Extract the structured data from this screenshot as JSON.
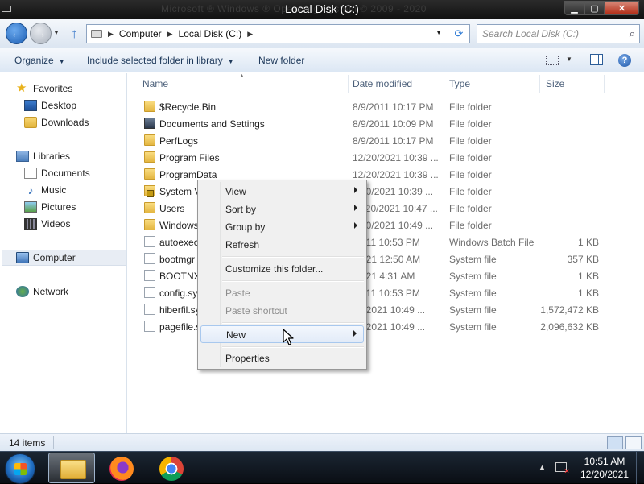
{
  "window": {
    "title": "Local Disk (C:)",
    "ghost_title": "Microsoft ® Windows ® Operating System © 2009 - 2020"
  },
  "address": {
    "crumbs": [
      "Computer",
      "Local Disk (C:)"
    ],
    "search_placeholder": "Search Local Disk (C:)"
  },
  "toolbar": {
    "organize": "Organize",
    "include": "Include selected folder in library",
    "new_folder": "New folder"
  },
  "nav": {
    "favorites": "Favorites",
    "desktop": "Desktop",
    "downloads": "Downloads",
    "libraries": "Libraries",
    "documents": "Documents",
    "music": "Music",
    "pictures": "Pictures",
    "videos": "Videos",
    "computer": "Computer",
    "network": "Network"
  },
  "columns": {
    "name": "Name",
    "date": "Date modified",
    "type": "Type",
    "size": "Size"
  },
  "files": [
    {
      "name": "$Recycle.Bin",
      "date": "8/9/2011 10:17 PM",
      "type": "File folder",
      "size": "",
      "icon": "folder"
    },
    {
      "name": "Documents and Settings",
      "date": "8/9/2011 10:09 PM",
      "type": "File folder",
      "size": "",
      "icon": "special"
    },
    {
      "name": "PerfLogs",
      "date": "8/9/2011 10:17 PM",
      "type": "File folder",
      "size": "",
      "icon": "folder"
    },
    {
      "name": "Program Files",
      "date": "12/20/2021 10:39 ...",
      "type": "File folder",
      "size": "",
      "icon": "folder"
    },
    {
      "name": "ProgramData",
      "date": "12/20/2021 10:39 ...",
      "type": "File folder",
      "size": "",
      "icon": "folder"
    },
    {
      "name": "System V",
      "date": "2/20/2021 10:39 ...",
      "type": "File folder",
      "size": "",
      "icon": "lock"
    },
    {
      "name": "Users",
      "date": "11/20/2021 10:47 ...",
      "type": "File folder",
      "size": "",
      "icon": "folder"
    },
    {
      "name": "Windows",
      "date": "2/20/2021 10:49 ...",
      "type": "File folder",
      "size": "",
      "icon": "folder"
    },
    {
      "name": "autoexec",
      "date": "/2011 10:53 PM",
      "type": "Windows Batch File",
      "size": "1 KB",
      "icon": "file"
    },
    {
      "name": "bootmgr",
      "date": "/2021 12:50 AM",
      "type": "System file",
      "size": "357 KB",
      "icon": "file"
    },
    {
      "name": "BOOTNX",
      "date": "/2021 4:31 AM",
      "type": "System file",
      "size": "1 KB",
      "icon": "file"
    },
    {
      "name": "config.sy",
      "date": "/2011 10:53 PM",
      "type": "System file",
      "size": "1 KB",
      "icon": "file"
    },
    {
      "name": "hiberfil.sy",
      "date": "20/2021 10:49 ...",
      "type": "System file",
      "size": "1,572,472 KB",
      "icon": "file"
    },
    {
      "name": "pagefile.s",
      "date": "20/2021 10:49 ...",
      "type": "System file",
      "size": "2,096,632 KB",
      "icon": "file"
    }
  ],
  "context_menu": {
    "view": "View",
    "sort_by": "Sort by",
    "group_by": "Group by",
    "refresh": "Refresh",
    "customize": "Customize this folder...",
    "paste": "Paste",
    "paste_shortcut": "Paste shortcut",
    "new": "New",
    "properties": "Properties"
  },
  "status": {
    "count": "14 items"
  },
  "clock": {
    "time": "10:51 AM",
    "date": "12/20/2021"
  }
}
